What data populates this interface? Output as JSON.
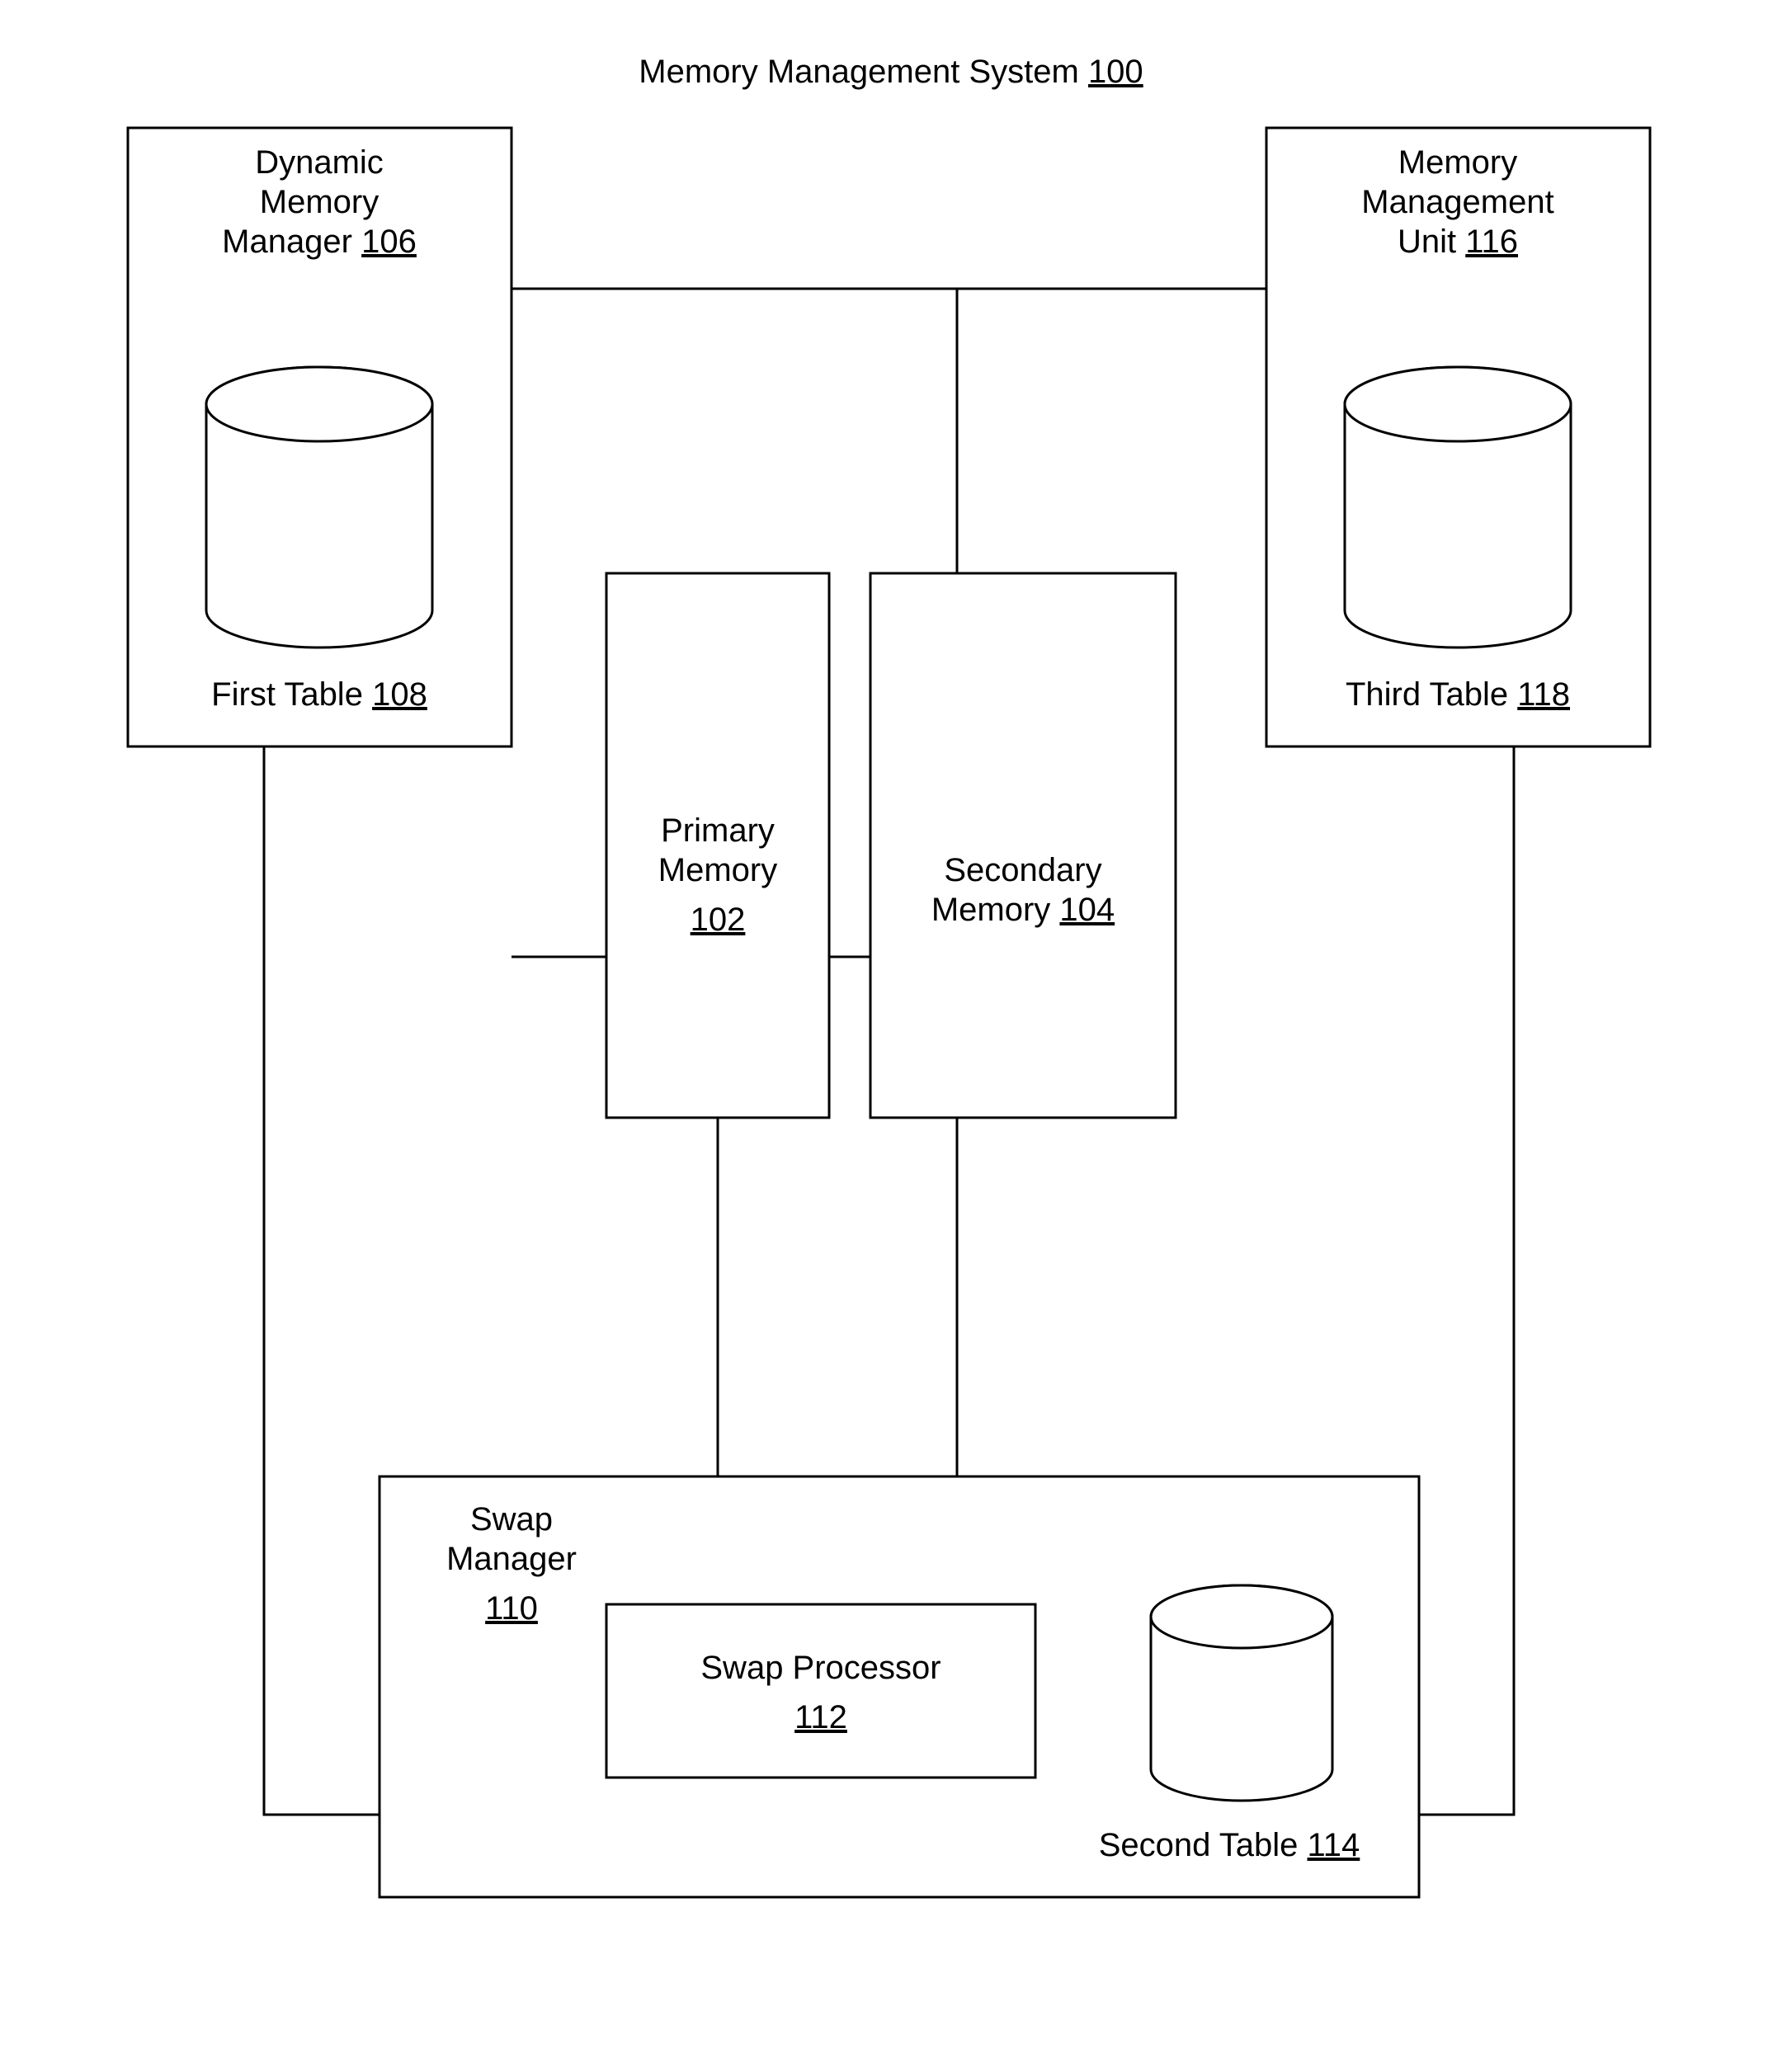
{
  "title_main": "Memory Management System",
  "title_ref": "100",
  "dmm": {
    "l1": "Dynamic",
    "l2": "Memory",
    "l3": "Manager",
    "ref": "106",
    "table_label": "First Table",
    "table_ref": "108"
  },
  "mmu": {
    "l1": "Memory",
    "l2": "Management",
    "l3": "Unit",
    "ref": "116",
    "table_label": "Third Table",
    "table_ref": "118"
  },
  "pmem": {
    "l1": "Primary",
    "l2": "Memory",
    "ref": "102"
  },
  "smem": {
    "l1": "Secondary",
    "l2": "Memory",
    "ref": "104"
  },
  "swapmgr": {
    "l1": "Swap",
    "l2": "Manager",
    "ref": "110",
    "proc_l1": "Swap Processor",
    "proc_ref": "112",
    "table_label": "Second Table",
    "table_ref": "114"
  }
}
